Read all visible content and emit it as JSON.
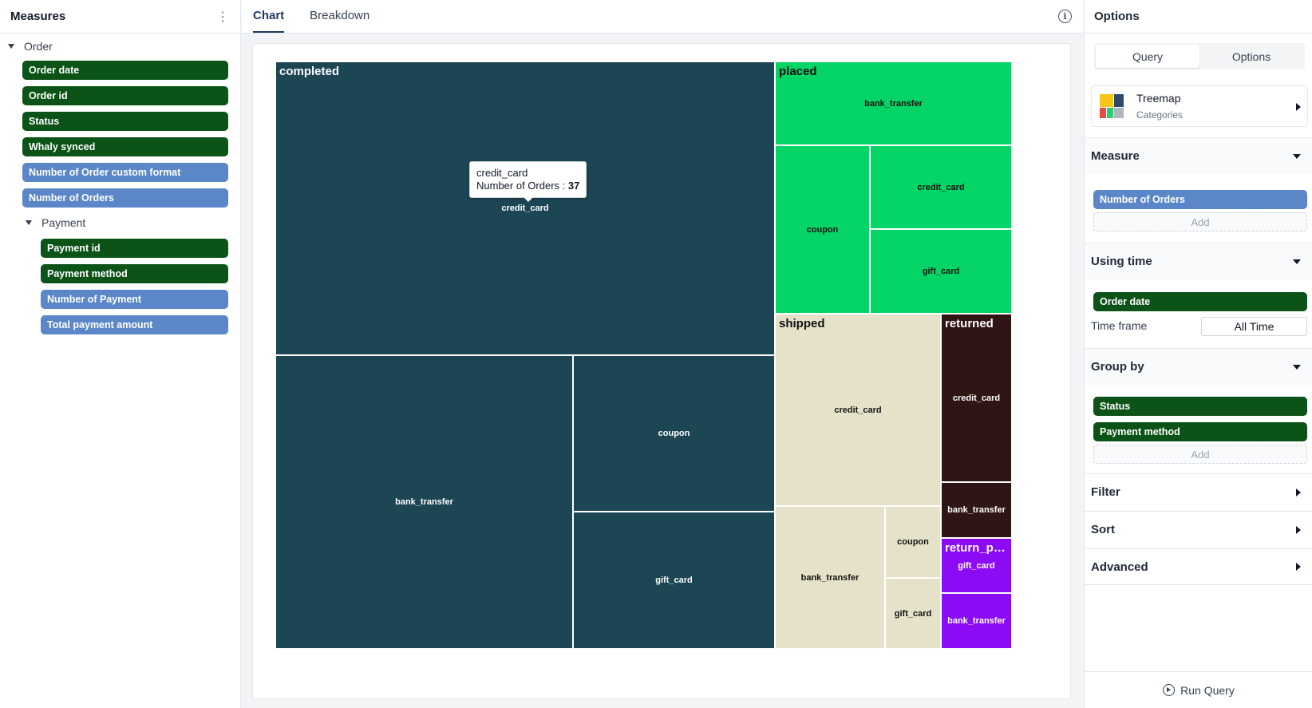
{
  "left_panel": {
    "title": "Measures",
    "order_group": "Order",
    "order_fields": [
      {
        "label": "Order date",
        "kind": "dimension"
      },
      {
        "label": "Order id",
        "kind": "dimension"
      },
      {
        "label": "Status",
        "kind": "dimension"
      },
      {
        "label": "Whaly synced",
        "kind": "dimension"
      },
      {
        "label": "Number of Order custom format",
        "kind": "measure"
      },
      {
        "label": "Number of Orders",
        "kind": "measure"
      }
    ],
    "payment_group": "Payment",
    "payment_fields": [
      {
        "label": "Payment id",
        "kind": "dimension"
      },
      {
        "label": "Payment method",
        "kind": "dimension"
      },
      {
        "label": "Number of Payment",
        "kind": "measure"
      },
      {
        "label": "Total payment amount",
        "kind": "measure"
      }
    ]
  },
  "center": {
    "tabs": [
      "Chart",
      "Breakdown"
    ],
    "active_tab": "Chart",
    "info_icon": "i"
  },
  "chart_data": {
    "type": "treemap",
    "groups": [
      {
        "name": "completed",
        "color": "#1c4654",
        "text_color": "#ffffff",
        "children": [
          {
            "name": "credit_card",
            "value": 37
          },
          {
            "name": "bank_transfer"
          },
          {
            "name": "coupon"
          },
          {
            "name": "gift_card"
          }
        ]
      },
      {
        "name": "placed",
        "color": "#05d466",
        "text_color": "#111111",
        "children": [
          {
            "name": "bank_transfer"
          },
          {
            "name": "coupon"
          },
          {
            "name": "credit_card"
          },
          {
            "name": "gift_card"
          }
        ]
      },
      {
        "name": "shipped",
        "color": "#e6e2ca",
        "text_color": "#111111",
        "children": [
          {
            "name": "credit_card"
          },
          {
            "name": "bank_transfer"
          },
          {
            "name": "coupon"
          },
          {
            "name": "gift_card"
          }
        ]
      },
      {
        "name": "returned",
        "color": "#2f1514",
        "text_color": "#ffffff",
        "children": [
          {
            "name": "credit_card"
          },
          {
            "name": "bank_transfer"
          }
        ]
      },
      {
        "name": "return_pen...",
        "color": "#8b0bf5",
        "text_color": "#ffffff",
        "children": [
          {
            "name": "gift_card"
          },
          {
            "name": "bank_transfer"
          }
        ]
      }
    ],
    "tooltip": {
      "category": "credit_card",
      "measure": "Number of Orders",
      "separator": " : ",
      "value": "37"
    }
  },
  "right_panel": {
    "title": "Options",
    "segments": [
      "Query",
      "Options"
    ],
    "active_segment": "Query",
    "chart_type": {
      "name": "Treemap",
      "category": "Categories"
    },
    "measure": {
      "title": "Measure",
      "items": [
        "Number of Orders"
      ],
      "add": "Add"
    },
    "using_time": {
      "title": "Using time",
      "items": [
        "Order date"
      ],
      "time_frame_label": "Time frame",
      "time_frame_value": "All Time"
    },
    "group_by": {
      "title": "Group by",
      "items": [
        "Status",
        "Payment method"
      ],
      "add": "Add"
    },
    "filter": "Filter",
    "sort": "Sort",
    "advanced": "Advanced",
    "run_query": "Run Query"
  }
}
